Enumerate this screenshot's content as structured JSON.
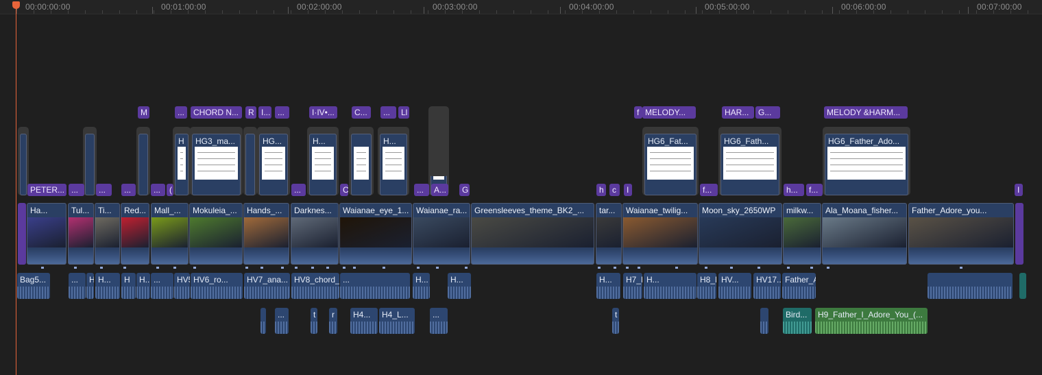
{
  "ruler": {
    "timecodes": [
      "00:00:00:00",
      "00:01:00:00",
      "00:02:00:00",
      "00:03:00:00",
      "00:04:00:00",
      "00:05:00:00",
      "00:06:00:00",
      "00:07:00:00"
    ]
  },
  "titles_row1": [
    "M",
    "...",
    "CHORD N...",
    "R",
    "I...",
    "...",
    "I·IV•...",
    "C...",
    "...",
    "Ll",
    "f",
    "MELODY...",
    "HAR...",
    "G...",
    "MELODY &HARM..."
  ],
  "stacks": [
    "",
    "",
    "",
    "H",
    "HG3_ma...",
    "",
    "HG...",
    "H...",
    "",
    "H...",
    "H",
    "HG6_Fat...",
    "HG6_Fath...",
    "HG6_Father_Ado..."
  ],
  "titles_row2": [
    "PETER...",
    "...",
    "...",
    "...",
    "...",
    "(",
    "...",
    "C",
    "...",
    "A...",
    "G",
    "h",
    "c",
    "I",
    "f...",
    "h...",
    "f...",
    "I"
  ],
  "primary": [
    "Ha...",
    "Tul...",
    "Ti...",
    "Red...",
    "Mall_...",
    "Mokuleia_...",
    "Hands_...",
    "Darknes...",
    "Waianae_eye_1...",
    "Waianae_ra...",
    "Greensleeves_theme_BK2_...",
    "tar...",
    "Waianae_twilig...",
    "Moon_sky_2650WP",
    "milkw...",
    "Ala_Moana_fisher...",
    "Father_Adore_you..."
  ],
  "audio_row1": [
    "Bag5...",
    "...",
    "H",
    "H...",
    "H",
    "H...",
    "...",
    "HV5_chor...",
    "HV6_ro...",
    "HV7_ana...",
    "HV8_chord_sy...",
    "...",
    "H...",
    "H...",
    "H...",
    "H7_Father...",
    "H...",
    "H8_F...",
    "HV...",
    "HV17...",
    "Father_Adore_you..."
  ],
  "audio_row2": [
    "...",
    "t",
    "r",
    "H4...",
    "H4_L...",
    "...",
    "t",
    "Bird...",
    "H9_Father_I_Adore_You_(..."
  ],
  "colors": {
    "background": "#1f1f1f",
    "title": "#5b3a9e",
    "primary": "#2a3f63",
    "audio": "#2d4670",
    "playhead": "#e8643a",
    "teal": "#1f6b67",
    "green": "#3d7a3f"
  }
}
